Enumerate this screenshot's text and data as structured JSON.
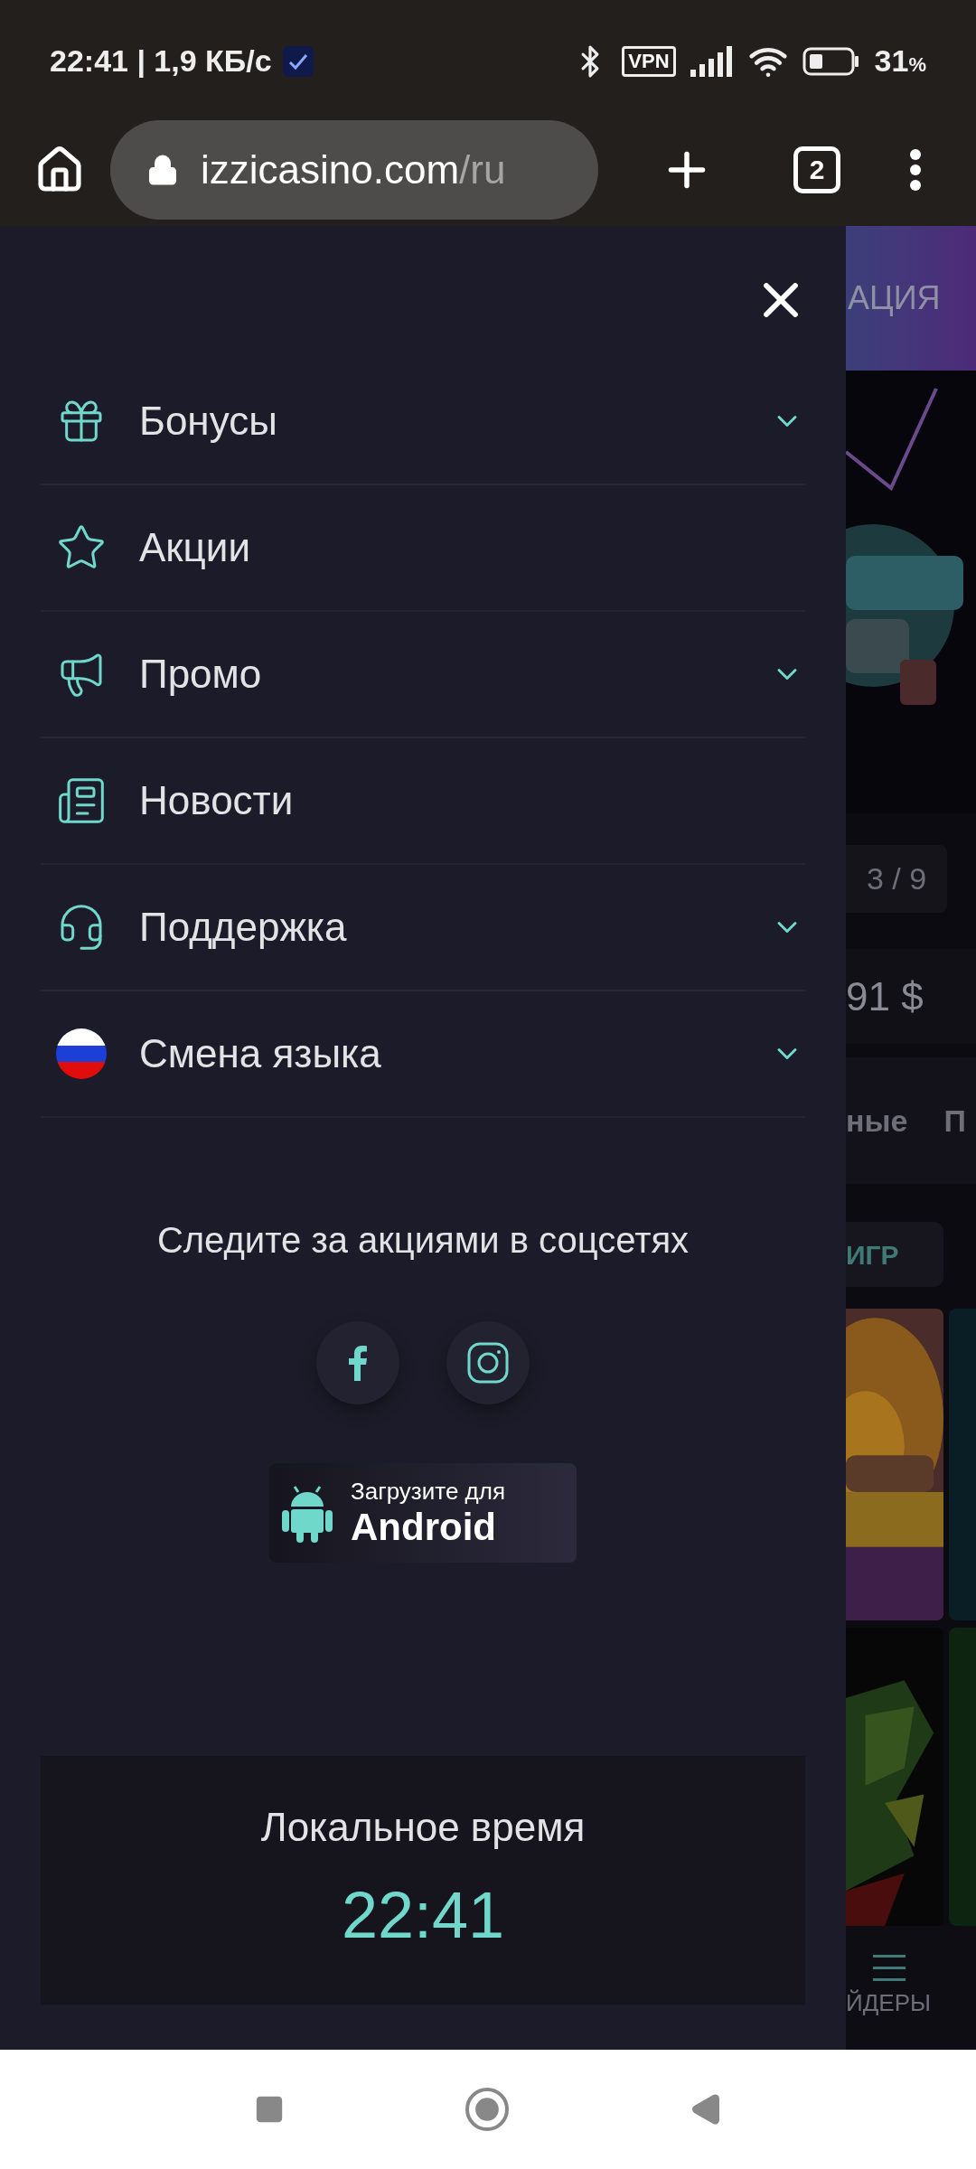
{
  "status_bar": {
    "time_speed": "22:41 | 1,9 КБ/с",
    "vpn": "VPN",
    "battery": "31",
    "battery_unit": "%"
  },
  "browser": {
    "url_host": "izzicasino.com",
    "url_path": "/ru",
    "tab_count": "2"
  },
  "menu": {
    "items": [
      {
        "kind": "gift",
        "label": "Бонусы",
        "expandable": true
      },
      {
        "kind": "star",
        "label": "Акции",
        "expandable": false
      },
      {
        "kind": "megaphone",
        "label": "Промо",
        "expandable": true
      },
      {
        "kind": "news",
        "label": "Новости",
        "expandable": false
      },
      {
        "kind": "support",
        "label": "Поддержка",
        "expandable": true
      },
      {
        "kind": "flag",
        "label": "Смена языка",
        "expandable": true
      }
    ],
    "social_title": "Следите за акциями в соцсетях",
    "social": [
      {
        "kind": "facebook"
      },
      {
        "kind": "instagram"
      }
    ],
    "app_button": {
      "caption": "Загрузите для",
      "platform": "Android"
    },
    "local_time": {
      "label": "Локальное время",
      "time": "22:41"
    }
  },
  "background_page": {
    "banner": "АЦИЯ",
    "slide_counter": "3 / 9",
    "amount": "91 $",
    "tab_1": "ные",
    "tab_2": "П",
    "games_button": "ИГР",
    "nav_label": "ЙДЕРЫ"
  }
}
